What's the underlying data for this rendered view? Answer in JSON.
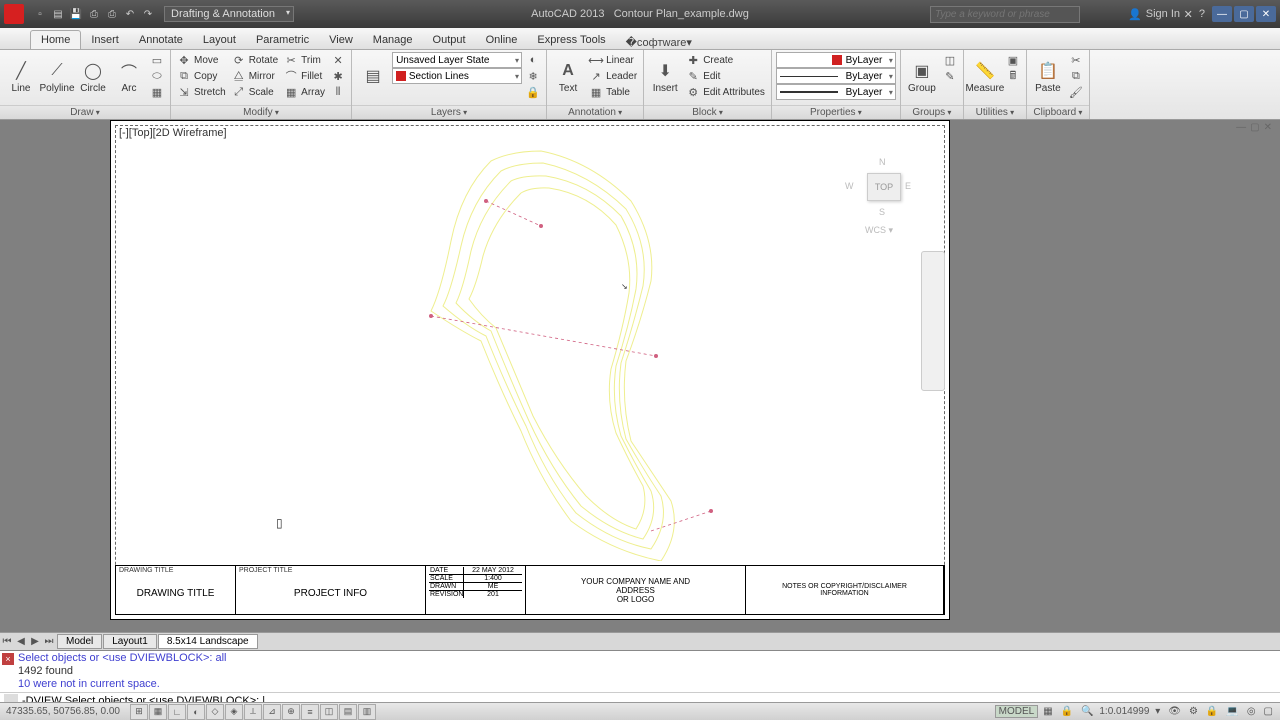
{
  "titlebar": {
    "workspace": "Drafting & Annotation",
    "app": "AutoCAD 2013",
    "file": "Contour Plan_example.dwg",
    "search_placeholder": "Type a keyword or phrase",
    "signin": "Sign In"
  },
  "tabs": [
    "Home",
    "Insert",
    "Annotate",
    "Layout",
    "Parametric",
    "View",
    "Manage",
    "Output",
    "Online",
    "Express Tools"
  ],
  "panels": {
    "draw": {
      "title": "Draw",
      "line": "Line",
      "polyline": "Polyline",
      "circle": "Circle",
      "arc": "Arc"
    },
    "modify": {
      "title": "Modify",
      "move": "Move",
      "rotate": "Rotate",
      "trim": "Trim",
      "copy": "Copy",
      "mirror": "Mirror",
      "fillet": "Fillet",
      "stretch": "Stretch",
      "scale": "Scale",
      "array": "Array"
    },
    "layers": {
      "title": "Layers",
      "state": "Unsaved Layer State",
      "current": "Section Lines"
    },
    "annotation": {
      "title": "Annotation",
      "text": "Text",
      "linear": "Linear",
      "leader": "Leader",
      "table": "Table"
    },
    "block": {
      "title": "Block",
      "insert": "Insert",
      "create": "Create",
      "edit": "Edit",
      "editattr": "Edit Attributes"
    },
    "properties": {
      "title": "Properties",
      "color": "ByLayer",
      "line": "ByLayer",
      "weight": "ByLayer"
    },
    "groups": {
      "title": "Groups",
      "group": "Group"
    },
    "utilities": {
      "title": "Utilities",
      "measure": "Measure"
    },
    "clipboard": {
      "title": "Clipboard",
      "paste": "Paste"
    }
  },
  "viewport": {
    "label": "[-][Top][2D Wireframe]",
    "cube": {
      "face": "TOP",
      "n": "N",
      "s": "S",
      "e": "E",
      "w": "W",
      "wcs": "WCS ▾"
    }
  },
  "titleblock": {
    "drawing_title_label": "DRAWING TITLE",
    "drawing_title": "DRAWING TITLE",
    "project_title_label": "PROJECT TITLE",
    "project_title": "PROJECT INFO",
    "date_label": "DATE",
    "date": "22 MAY 2012",
    "scale_label": "SCALE",
    "scale": "1:400",
    "drawn_label": "DRAWN",
    "drawn": "ME",
    "revision_label": "REVISION",
    "revision": "201",
    "company": "YOUR COMPANY NAME AND\nADDRESS\nOR LOGO",
    "notes": "NOTES OR COPYRIGHT/DISCLAIMER\nINFORMATION"
  },
  "layout_tabs": [
    "Model",
    "Layout1",
    "8.5x14 Landscape"
  ],
  "command": {
    "hist1": "Select objects or <use DVIEWBLOCK>: all",
    "hist2": "1492 found",
    "hist3": "10 were not in current space.",
    "prompt": "DVIEW Select objects or <use DVIEWBLOCK>:"
  },
  "status": {
    "coords": "47335.65, 50756.85, 0.00",
    "model": "MODEL",
    "scale": "1:0.014999"
  }
}
